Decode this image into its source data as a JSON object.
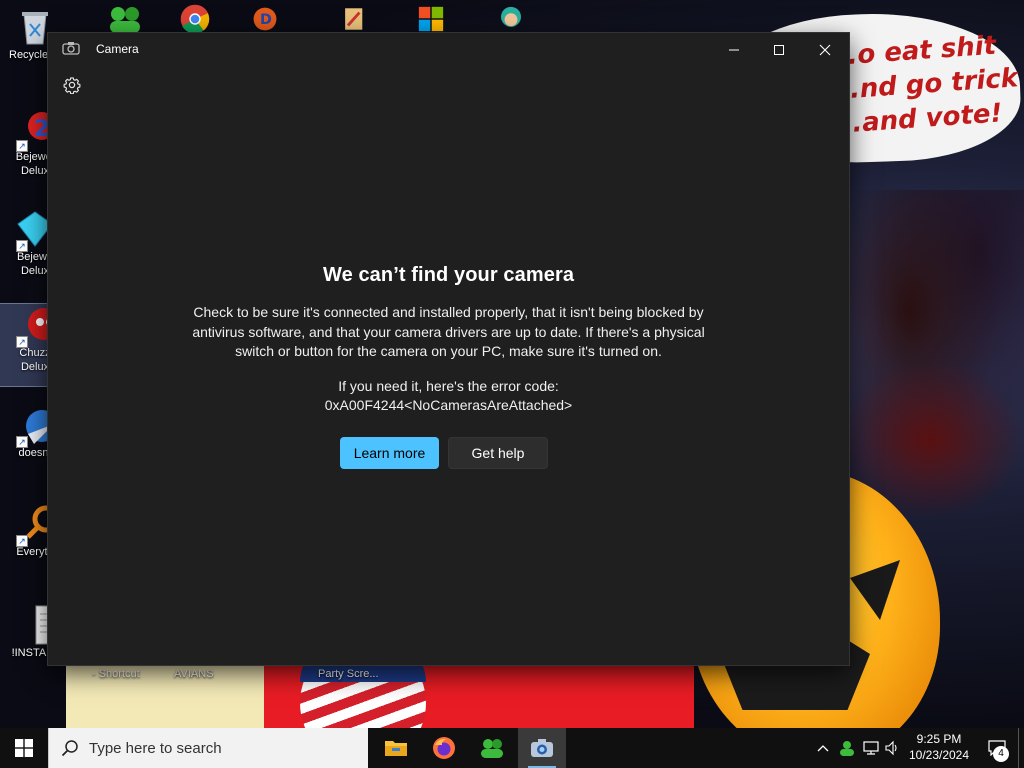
{
  "desktop": {
    "wallpaper_text": "...o eat shit\n...nd go trick\n...and vote!",
    "icons": [
      {
        "label": "Recycle"
      },
      {
        "label": "Bejewel\nDelux"
      },
      {
        "label": "Bejewe\nDelux"
      },
      {
        "label": "Chuzz\nDelux"
      },
      {
        "label": "doesnt"
      },
      {
        "label": "Everyth"
      },
      {
        "label": "!INSTALL"
      }
    ],
    "bottom_labels": [
      "- Shortcut",
      "AVIANS",
      "Party Scre..."
    ]
  },
  "window": {
    "title": "Camera",
    "controls": {
      "minimize": "Minimize",
      "maximize": "Maximize",
      "close": "Close"
    },
    "error": {
      "title": "We can’t find your camera",
      "body": "Check to be sure it's connected and installed properly, that it isn't being blocked by antivirus software, and that your camera drivers are up to date. If there's a physical switch or button for the camera on your PC, make sure it's turned on.",
      "code_label": "If you need it, here's the error code:",
      "code": "0xA00F4244<NoCamerasAreAttached>"
    },
    "buttons": {
      "learn_more": "Learn more",
      "get_help": "Get help"
    }
  },
  "taskbar": {
    "search": {
      "placeholder": "Type here to search"
    },
    "clock": {
      "time": "9:25 PM",
      "date": "10/23/2024"
    },
    "notification_count": "4",
    "accent": "#4cc2ff"
  }
}
